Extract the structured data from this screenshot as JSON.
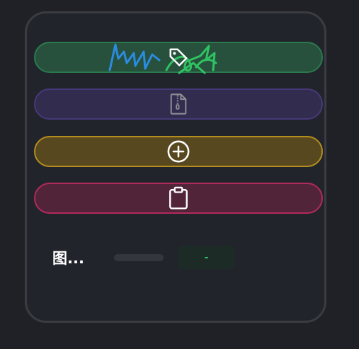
{
  "colors": {
    "background": "#1f2126",
    "panel": "#22242b",
    "panel_border": "#3a3c42",
    "tag_button": {
      "fill": "#27513c",
      "border": "#2b7a4e",
      "icon": "#ffffff"
    },
    "zip_button": {
      "fill": "#322c4e",
      "border": "#46397a",
      "icon": "#8c8c96"
    },
    "add_button": {
      "fill": "#57481f",
      "border": "#b48d1e",
      "icon": "#ffffff"
    },
    "clipboard_button": {
      "fill": "#52243a",
      "border": "#b12a5c",
      "icon": "#ffffff"
    },
    "scribble_blue": "#2b8be0",
    "scribble_green": "#2fc261",
    "value_text": "#2dbf6f"
  },
  "buttons": [
    {
      "id": "tag",
      "icon": "tag-icon"
    },
    {
      "id": "zip",
      "icon": "zip-file-icon"
    },
    {
      "id": "add",
      "icon": "plus-circle-icon"
    },
    {
      "id": "clipboard",
      "icon": "clipboard-icon"
    }
  ],
  "setting": {
    "label": "图...",
    "value": "-"
  }
}
